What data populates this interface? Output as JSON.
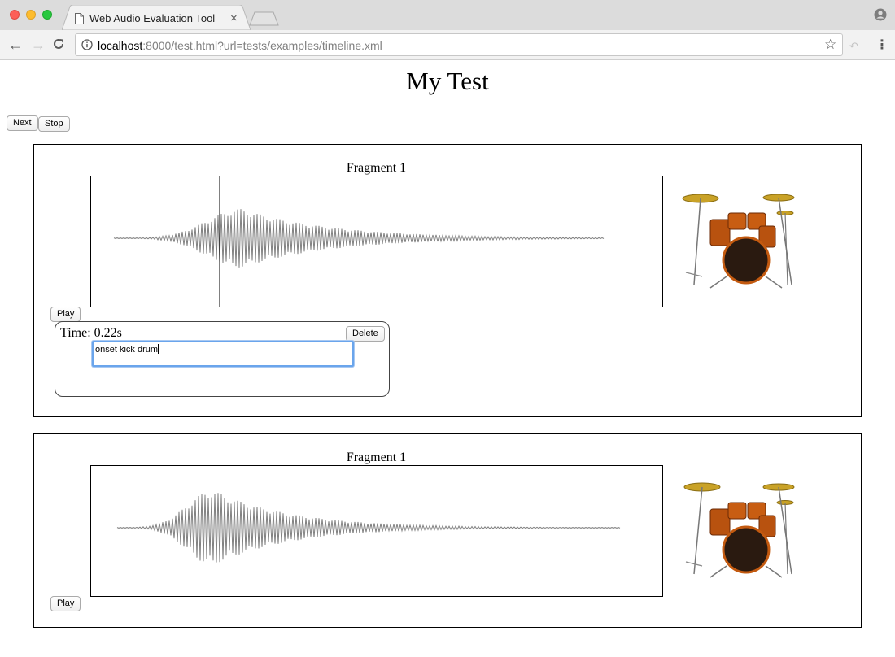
{
  "browser": {
    "tab_title": "Web Audio Evaluation Tool",
    "tab_close": "×",
    "url_host": "localhost",
    "url_rest": ":8000/test.html?url=tests/examples/timeline.xml"
  },
  "page": {
    "title": "My Test",
    "next_label": "Next",
    "stop_label": "Stop"
  },
  "fragments": [
    {
      "label": "Fragment 1",
      "play_label": "Play",
      "comment": {
        "time_text": "Time: 0.22s",
        "delete_label": "Delete",
        "text": "onset kick drum"
      }
    },
    {
      "label": "Fragment 1",
      "play_label": "Play"
    }
  ],
  "colors": {
    "waveform": "#808080",
    "focus_ring": "#6aa5ec"
  },
  "icons": [
    "document-icon",
    "close-icon",
    "back-icon",
    "forward-icon",
    "reload-icon",
    "info-icon",
    "star-icon",
    "menu-icon",
    "profile-icon",
    "drum-kit-image"
  ]
}
